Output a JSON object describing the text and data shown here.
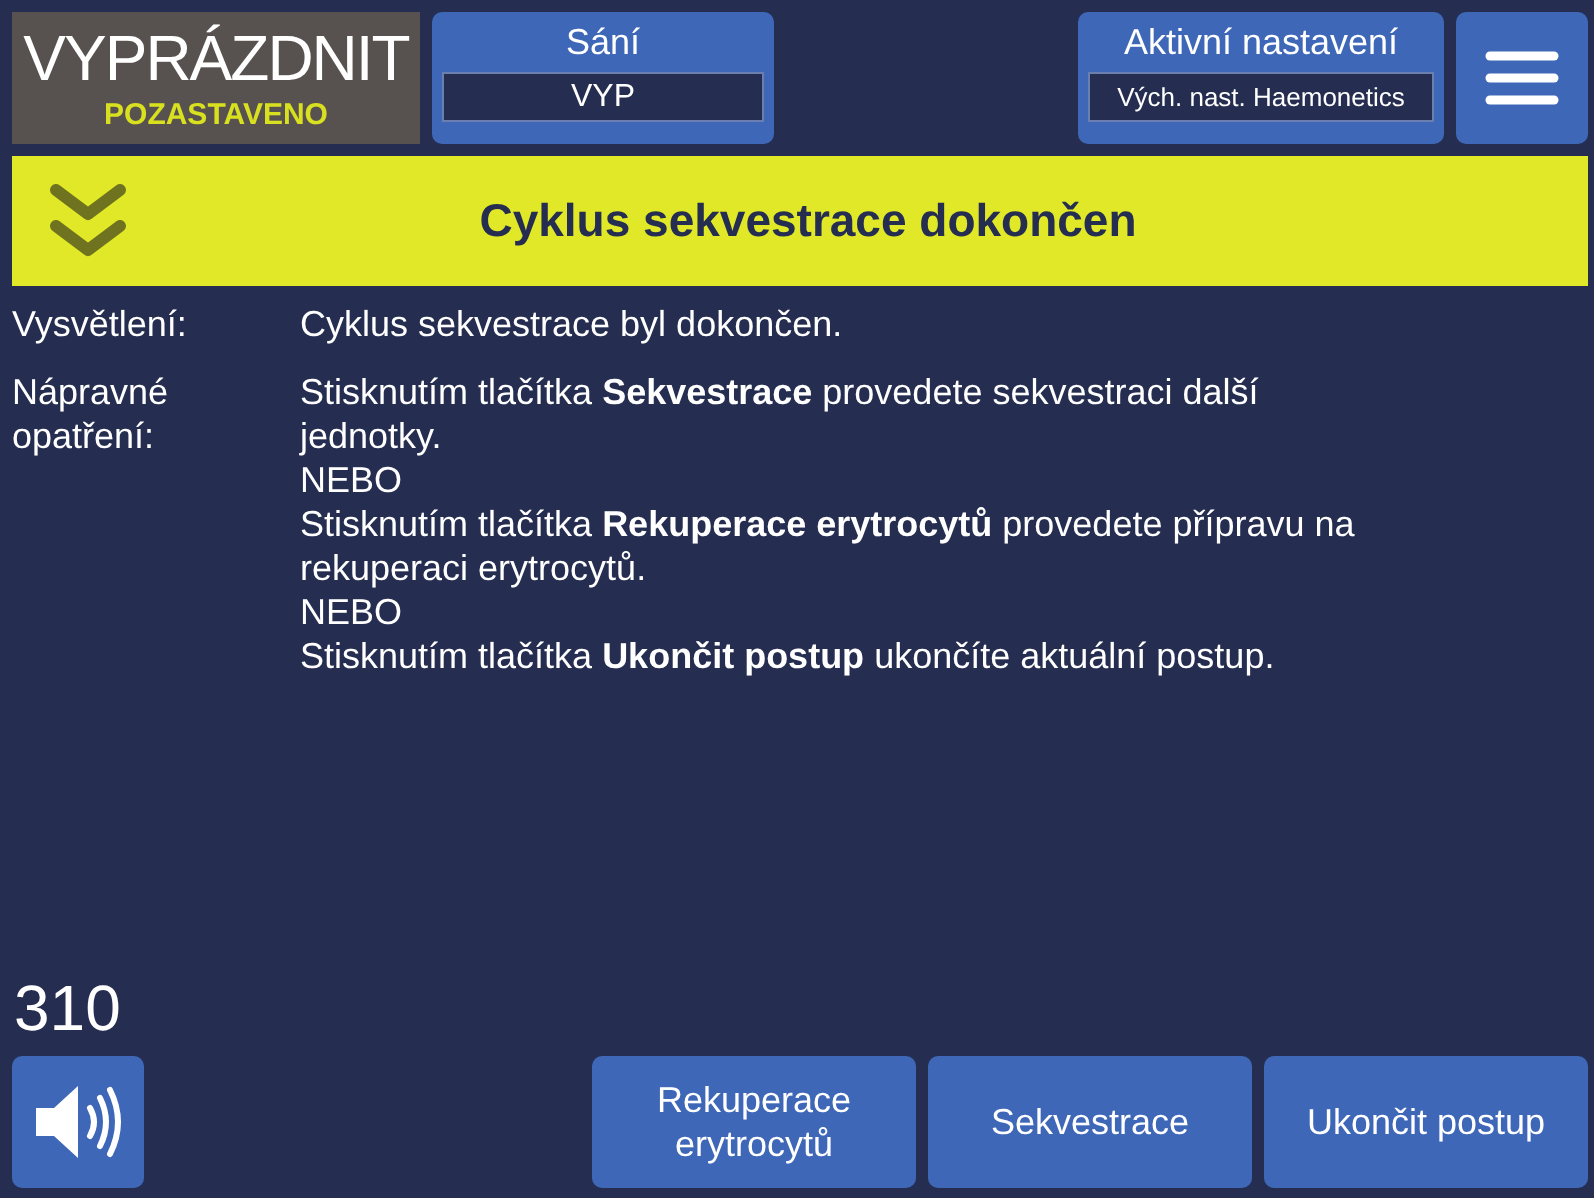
{
  "status": {
    "title": "VYPRÁZDNIT",
    "state": "POZASTAVENO"
  },
  "suction": {
    "label": "Sání",
    "value": "VYP"
  },
  "preset": {
    "label": "Aktivní nastavení",
    "value": "Vých. nast. Haemonetics"
  },
  "banner": {
    "title": "Cyklus sekvestrace dokončen"
  },
  "details": [
    {
      "label": "Vysvětlení:",
      "lines": [
        "Cyklus sekvestrace byl dokončen."
      ]
    },
    {
      "label": "Nápravné opatření:",
      "lines": [
        "Stisknutím tlačítka **Sekvestrace** provedete sekvestraci další jednotky.",
        "NEBO",
        "Stisknutím tlačítka **Rekuperace erytrocytů** provedete přípravu na rekuperaci erytrocytů.",
        "NEBO",
        "Stisknutím tlačítka **Ukončit postup** ukončíte aktuální postup."
      ]
    }
  ],
  "counter": "310",
  "actions": [
    "Rekuperace erytrocytů",
    "Sekvestrace",
    "Ukončit postup"
  ]
}
